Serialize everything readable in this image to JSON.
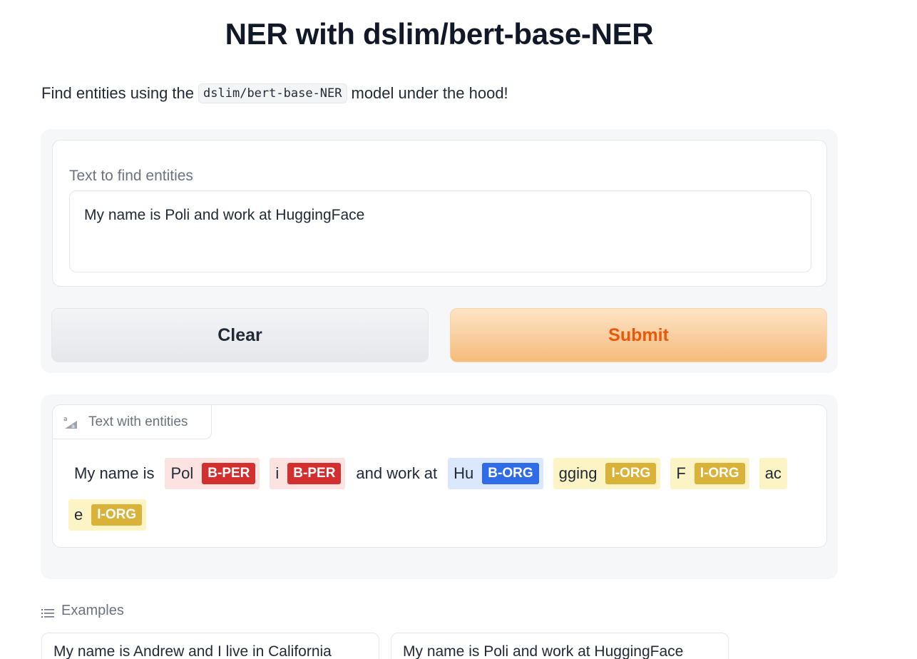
{
  "header": {
    "title": "NER with dslim/bert-base-NER",
    "description_before": "Find entities using the",
    "description_code": "dslim/bert-base-NER",
    "description_after": "model under the hood!"
  },
  "input": {
    "label": "Text to find entities",
    "value": "My name is Poli and work at HuggingFace"
  },
  "buttons": {
    "clear_label": "Clear",
    "submit_label": "Submit"
  },
  "output": {
    "label": "Text with entities",
    "icon": "text-entities-icon",
    "line1": {
      "plain1": "My name is",
      "ent1": {
        "text": "Pol",
        "tag": "B-PER"
      },
      "ent2": {
        "text": "i",
        "tag": "B-PER"
      },
      "plain2": "and work at",
      "ent3": {
        "text": "Hu",
        "tag": "B-ORG"
      },
      "ent4": {
        "text": "gging",
        "tag": "I-ORG"
      },
      "ent5": {
        "text": "F",
        "tag": "I-ORG"
      },
      "ent6": {
        "text": "ac"
      }
    },
    "line2": {
      "ent6_cont": {
        "text": "e",
        "tag": "I-ORG"
      }
    }
  },
  "examples": {
    "label": "Examples",
    "items": [
      "My name is Andrew and I live in California",
      "My name is Poli and work at HuggingFace"
    ]
  },
  "colors": {
    "per_tag": "#d32f2f",
    "per_bg": "#fde2e2",
    "borg_tag": "#2f6ce5",
    "borg_bg": "#dbe7fd",
    "iorg_tag": "#d9b23a",
    "iorg_bg": "#fcf4c4",
    "submit_text": "#ea580c"
  }
}
